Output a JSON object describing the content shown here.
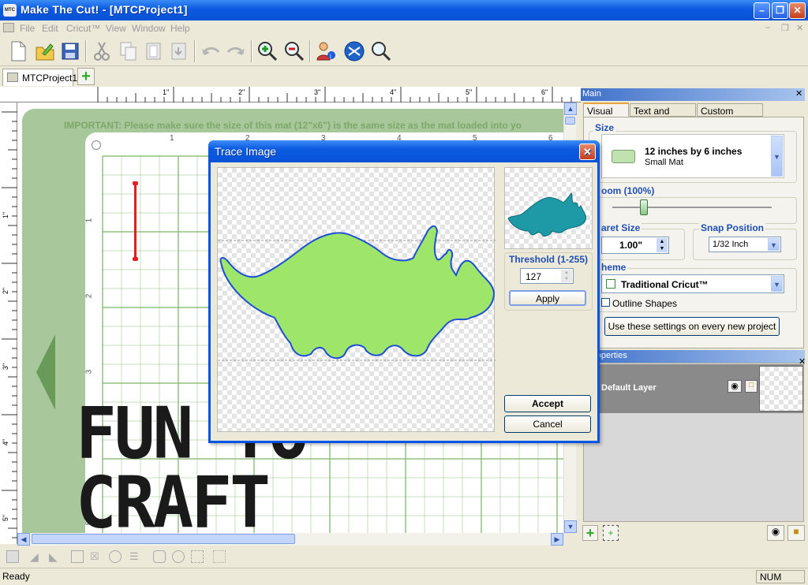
{
  "window": {
    "title": "Make The Cut! - [MTCProject1]",
    "app_icon_text": "MTC"
  },
  "menu": {
    "items": [
      "File",
      "Edit",
      "Cricut™",
      "View",
      "Window",
      "Help"
    ]
  },
  "toolbar": {
    "icons": [
      "new-document-icon",
      "open-folder-icon",
      "save-icon",
      "cut-icon",
      "copy-icon",
      "paste-icon",
      "paste-in-place-icon",
      "undo-icon",
      "redo-icon",
      "zoom-in-icon",
      "zoom-out-icon",
      "user-info-icon",
      "cut-send-icon",
      "magnifier-icon"
    ]
  },
  "document_tab": {
    "label": "MTCProject1"
  },
  "ruler": {
    "h_marks": [
      "1\"",
      "2\"",
      "3\"",
      "4\"",
      "5\"",
      "6\""
    ],
    "v_marks": [
      "1\"",
      "2\"",
      "3\"",
      "4\"",
      "5\""
    ]
  },
  "canvas": {
    "notice": "IMPORTANT: Please make sure the size of this mat (12\"x6\") is the same size as the mat loaded into yo",
    "mat_h_numbers": [
      "1",
      "2",
      "3",
      "4",
      "5",
      "6"
    ],
    "mat_v_numbers": [
      "1",
      "2",
      "3",
      "4",
      "5"
    ],
    "watermark_line1": "FUN TO",
    "watermark_line2": "CRAFT"
  },
  "trace_dialog": {
    "title": "Trace Image",
    "threshold_label": "Threshold (1-255)",
    "threshold_value": "127",
    "apply": "Apply",
    "accept": "Accept",
    "cancel": "Cancel"
  },
  "main_panel": {
    "header": "Main",
    "tabs": [
      "Visual Mat",
      "Text and Fonts",
      "Custom Shapes"
    ],
    "size_label": "Size",
    "size_value": "12 inches by 6 inches",
    "size_sub": "Small Mat",
    "zoom_label": "oom (100%)",
    "zoom_level": 0.2,
    "caret_label": "aret Size",
    "caret_value": "1.00\"",
    "snap_label": "Snap Position",
    "snap_value": "1/32 Inch",
    "theme_label": "heme",
    "theme_value": "Traditional Cricut™",
    "outline_label": "Outline Shapes",
    "use_settings": "Use these settings on every new project"
  },
  "layer_panel": {
    "header": "r Properties",
    "layer_name": "Default Layer"
  },
  "status": {
    "text": "Ready",
    "num": "NUM"
  },
  "colors": {
    "mat_green": "#a8c79a",
    "grid_line": "#8fbf7f",
    "shape_fill": "#9ee66a",
    "shape_stroke": "#1f4fd6",
    "preview_fill": "#1d9aa6",
    "notice_text": "#7ea86a"
  }
}
